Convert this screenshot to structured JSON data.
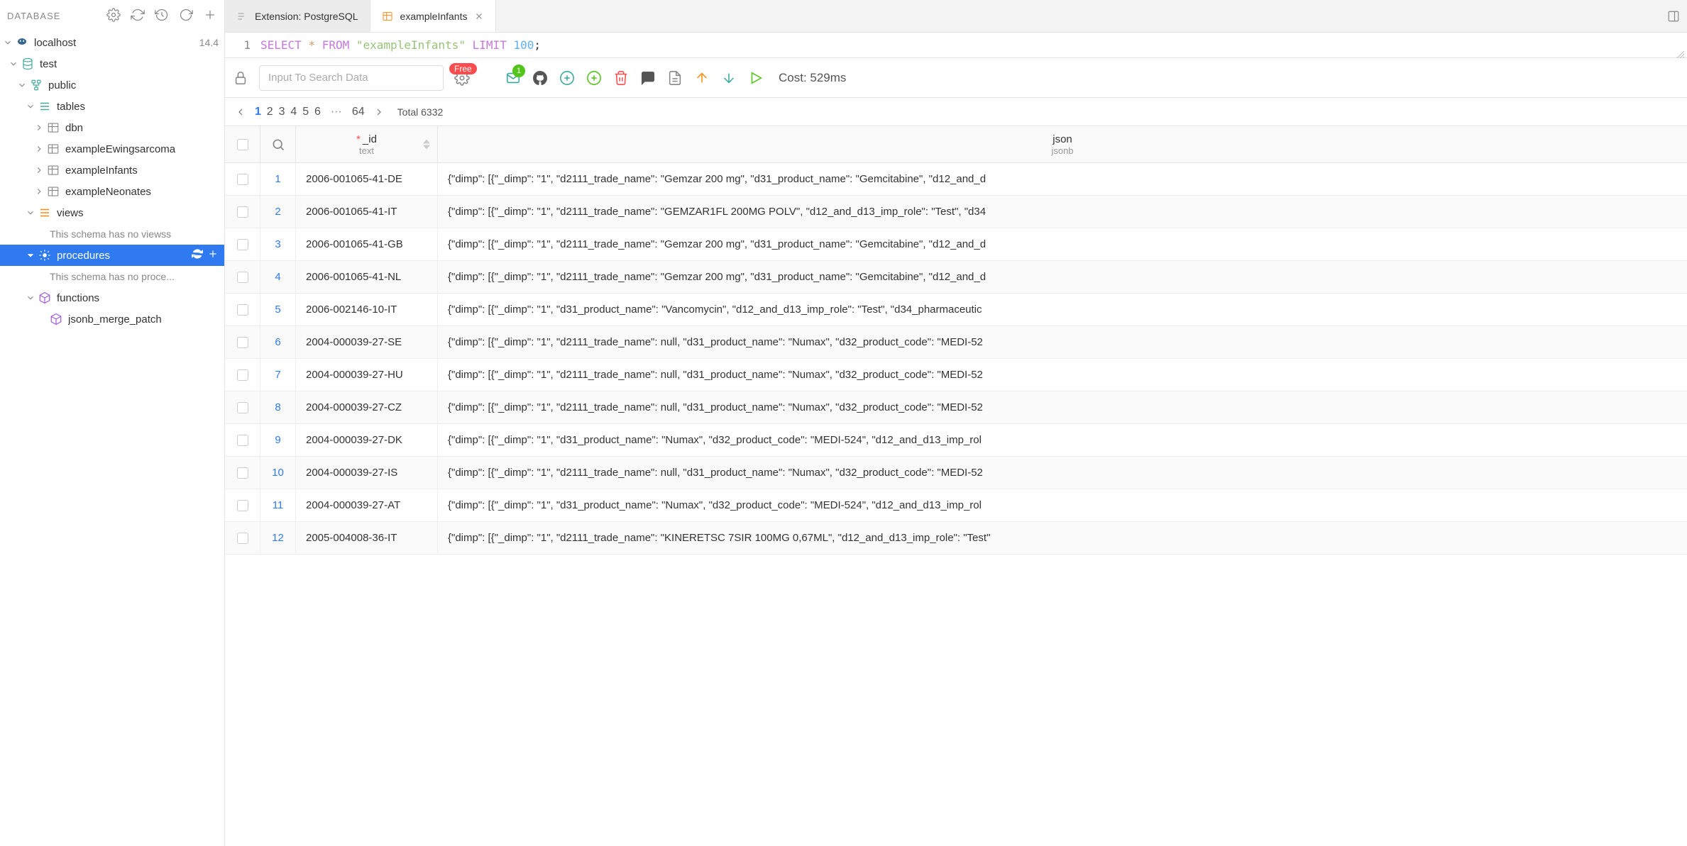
{
  "sidebar": {
    "title": "DATABASE",
    "connection": {
      "name": "localhost",
      "version": "14.4"
    },
    "db": "test",
    "schema": "public",
    "sections": {
      "tables": "tables",
      "views": "views",
      "procedures": "procedures",
      "functions": "functions"
    },
    "tables": [
      "dbn",
      "exampleEwingsarcoma",
      "exampleInfants",
      "exampleNeonates"
    ],
    "empty_views": "This schema has no viewss",
    "empty_procs": "This schema has no proce...",
    "functions_list": [
      "jsonb_merge_patch"
    ]
  },
  "tabs": [
    {
      "label": "Extension: PostgreSQL",
      "active": false,
      "closable": false
    },
    {
      "label": "exampleInfants",
      "active": true,
      "closable": true
    }
  ],
  "editor": {
    "line_no": "1",
    "kw_select": "SELECT",
    "kw_star": "*",
    "kw_from": "FROM",
    "str_table": "\"exampleInfants\"",
    "kw_limit": "LIMIT",
    "num_limit": "100",
    "semi": ";"
  },
  "toolbar": {
    "search_placeholder": "Input To Search Data",
    "badge_free": "Free",
    "badge_count": "1",
    "cost": "Cost: 529ms"
  },
  "pager": {
    "pages": [
      "1",
      "2",
      "3",
      "4",
      "5",
      "6"
    ],
    "dots": "···",
    "last": "64",
    "total": "Total 6332"
  },
  "grid": {
    "col_id_label": "_id",
    "col_id_type": "text",
    "col_json_label": "json",
    "col_json_type": "jsonb",
    "rows": [
      {
        "n": "1",
        "id": "2006-001065-41-DE",
        "json": "{\"dimp\": [{\"_dimp\": \"1\", \"d2111_trade_name\": \"Gemzar 200 mg\", \"d31_product_name\": \"Gemcitabine\", \"d12_and_d"
      },
      {
        "n": "2",
        "id": "2006-001065-41-IT",
        "json": "{\"dimp\": [{\"_dimp\": \"1\", \"d2111_trade_name\": \"GEMZAR1FL 200MG POLV\", \"d12_and_d13_imp_role\": \"Test\", \"d34"
      },
      {
        "n": "3",
        "id": "2006-001065-41-GB",
        "json": "{\"dimp\": [{\"_dimp\": \"1\", \"d2111_trade_name\": \"Gemzar 200 mg\", \"d31_product_name\": \"Gemcitabine\", \"d12_and_d"
      },
      {
        "n": "4",
        "id": "2006-001065-41-NL",
        "json": "{\"dimp\": [{\"_dimp\": \"1\", \"d2111_trade_name\": \"Gemzar 200 mg\", \"d31_product_name\": \"Gemcitabine\", \"d12_and_d"
      },
      {
        "n": "5",
        "id": "2006-002146-10-IT",
        "json": "{\"dimp\": [{\"_dimp\": \"1\", \"d31_product_name\": \"Vancomycin\", \"d12_and_d13_imp_role\": \"Test\", \"d34_pharmaceutic"
      },
      {
        "n": "6",
        "id": "2004-000039-27-SE",
        "json": "{\"dimp\": [{\"_dimp\": \"1\", \"d2111_trade_name\": null, \"d31_product_name\": \"Numax\", \"d32_product_code\": \"MEDI-52"
      },
      {
        "n": "7",
        "id": "2004-000039-27-HU",
        "json": "{\"dimp\": [{\"_dimp\": \"1\", \"d2111_trade_name\": null, \"d31_product_name\": \"Numax\", \"d32_product_code\": \"MEDI-52"
      },
      {
        "n": "8",
        "id": "2004-000039-27-CZ",
        "json": "{\"dimp\": [{\"_dimp\": \"1\", \"d2111_trade_name\": null, \"d31_product_name\": \"Numax\", \"d32_product_code\": \"MEDI-52"
      },
      {
        "n": "9",
        "id": "2004-000039-27-DK",
        "json": "{\"dimp\": [{\"_dimp\": \"1\", \"d31_product_name\": \"Numax\", \"d32_product_code\": \"MEDI-524\", \"d12_and_d13_imp_rol"
      },
      {
        "n": "10",
        "id": "2004-000039-27-IS",
        "json": "{\"dimp\": [{\"_dimp\": \"1\", \"d2111_trade_name\": null, \"d31_product_name\": \"Numax\", \"d32_product_code\": \"MEDI-52"
      },
      {
        "n": "11",
        "id": "2004-000039-27-AT",
        "json": "{\"dimp\": [{\"_dimp\": \"1\", \"d31_product_name\": \"Numax\", \"d32_product_code\": \"MEDI-524\", \"d12_and_d13_imp_rol"
      },
      {
        "n": "12",
        "id": "2005-004008-36-IT",
        "json": "{\"dimp\": [{\"_dimp\": \"1\", \"d2111_trade_name\": \"KINERETSC 7SIR 100MG 0,67ML\", \"d12_and_d13_imp_role\": \"Test\""
      }
    ]
  }
}
